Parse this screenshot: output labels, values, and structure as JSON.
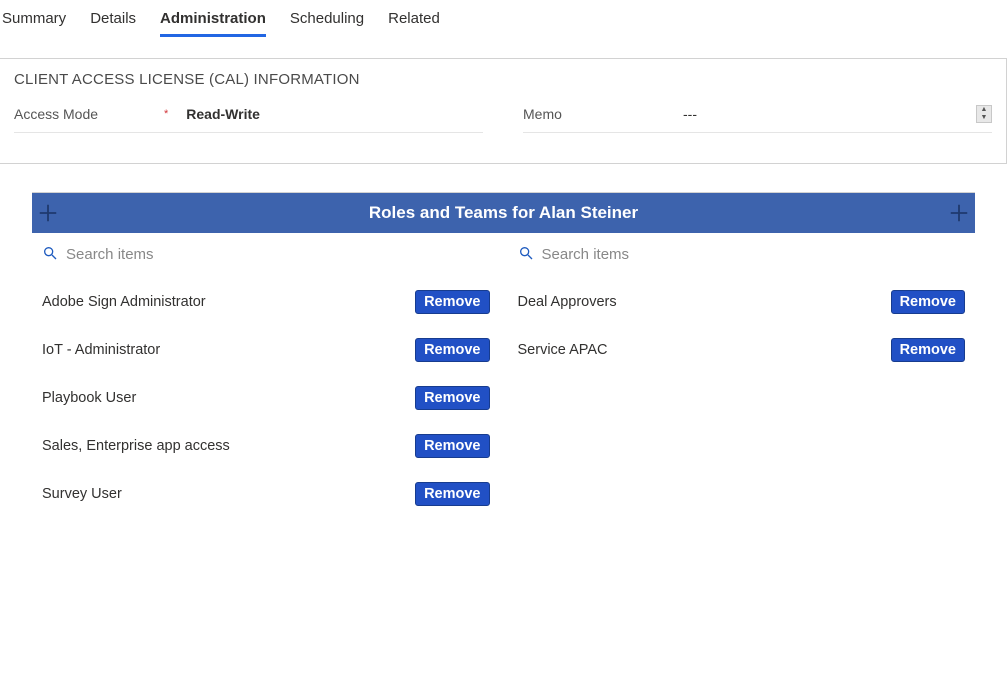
{
  "tabs": {
    "summary": "Summary",
    "details": "Details",
    "administration": "Administration",
    "scheduling": "Scheduling",
    "related": "Related"
  },
  "cal": {
    "section_title": "CLIENT ACCESS LICENSE (CAL) INFORMATION",
    "access_mode_label": "Access Mode",
    "access_mode_value": "Read-Write",
    "memo_label": "Memo",
    "memo_value": "---"
  },
  "roles": {
    "header_title": "Roles and Teams for Alan Steiner",
    "search_placeholder": "Search items",
    "remove_label": "Remove",
    "left_items": [
      {
        "name": "Adobe Sign Administrator"
      },
      {
        "name": "IoT - Administrator"
      },
      {
        "name": "Playbook User"
      },
      {
        "name": "Sales, Enterprise app access"
      },
      {
        "name": "Survey User"
      }
    ],
    "right_items": [
      {
        "name": "Deal Approvers"
      },
      {
        "name": "Service APAC"
      }
    ]
  }
}
